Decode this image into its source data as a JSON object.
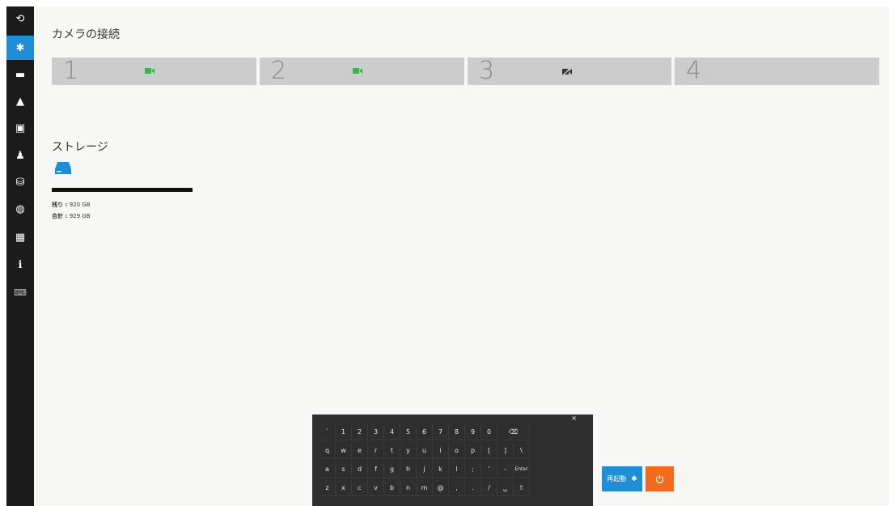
{
  "sidebar": {
    "items": [
      {
        "icon": "monitor-eye-icon",
        "glyph": "⟲"
      },
      {
        "icon": "gear-icon",
        "glyph": "✱",
        "active": true
      },
      {
        "icon": "video-camera-icon",
        "glyph": "▬"
      },
      {
        "icon": "bell-icon",
        "glyph": "▲"
      },
      {
        "icon": "computer-icon",
        "glyph": "▣"
      },
      {
        "icon": "user-icon",
        "glyph": "♟"
      },
      {
        "icon": "database-icon",
        "glyph": "⛁"
      },
      {
        "icon": "globe-icon",
        "glyph": "◍"
      },
      {
        "icon": "grid-icon",
        "glyph": "▦"
      },
      {
        "icon": "info-icon",
        "glyph": "ℹ"
      },
      {
        "icon": "keyboard-icon",
        "glyph": "⌨"
      }
    ]
  },
  "camera_section": {
    "title": "カメラの接続",
    "cameras": [
      {
        "number": "1",
        "status": "connected",
        "icon": "camera-connected-icon"
      },
      {
        "number": "2",
        "status": "connected",
        "icon": "camera-connected-icon"
      },
      {
        "number": "3",
        "status": "disconnected",
        "icon": "camera-off-icon"
      },
      {
        "number": "4",
        "status": "none",
        "icon": ""
      }
    ]
  },
  "storage_section": {
    "title": "ストレージ",
    "remaining_label": "残り",
    "remaining_value": "920 GB",
    "total_label": "合計",
    "total_value": "929 GB"
  },
  "keyboard": {
    "rows": [
      [
        "`",
        "1",
        "2",
        "3",
        "4",
        "5",
        "6",
        "7",
        "8",
        "9",
        "0",
        "⌫"
      ],
      [
        "q",
        "w",
        "e",
        "r",
        "t",
        "y",
        "u",
        "i",
        "o",
        "p",
        "[",
        "]",
        "\\"
      ],
      [
        "a",
        "s",
        "d",
        "f",
        "g",
        "h",
        "j",
        "k",
        "l",
        ";",
        "'",
        "-",
        "Enter"
      ],
      [
        "z",
        "x",
        "c",
        "v",
        "b",
        "n",
        "m",
        "@",
        ",",
        ".",
        "/",
        "␣",
        "⇧"
      ]
    ],
    "close": "×"
  },
  "buttons": {
    "restart_label": "再起動",
    "power_glyph": "⏻"
  },
  "colors": {
    "accent": "#1f8ed6",
    "connected": "#39b54a",
    "power": "#f26a1b",
    "tile": "#cccccc"
  }
}
